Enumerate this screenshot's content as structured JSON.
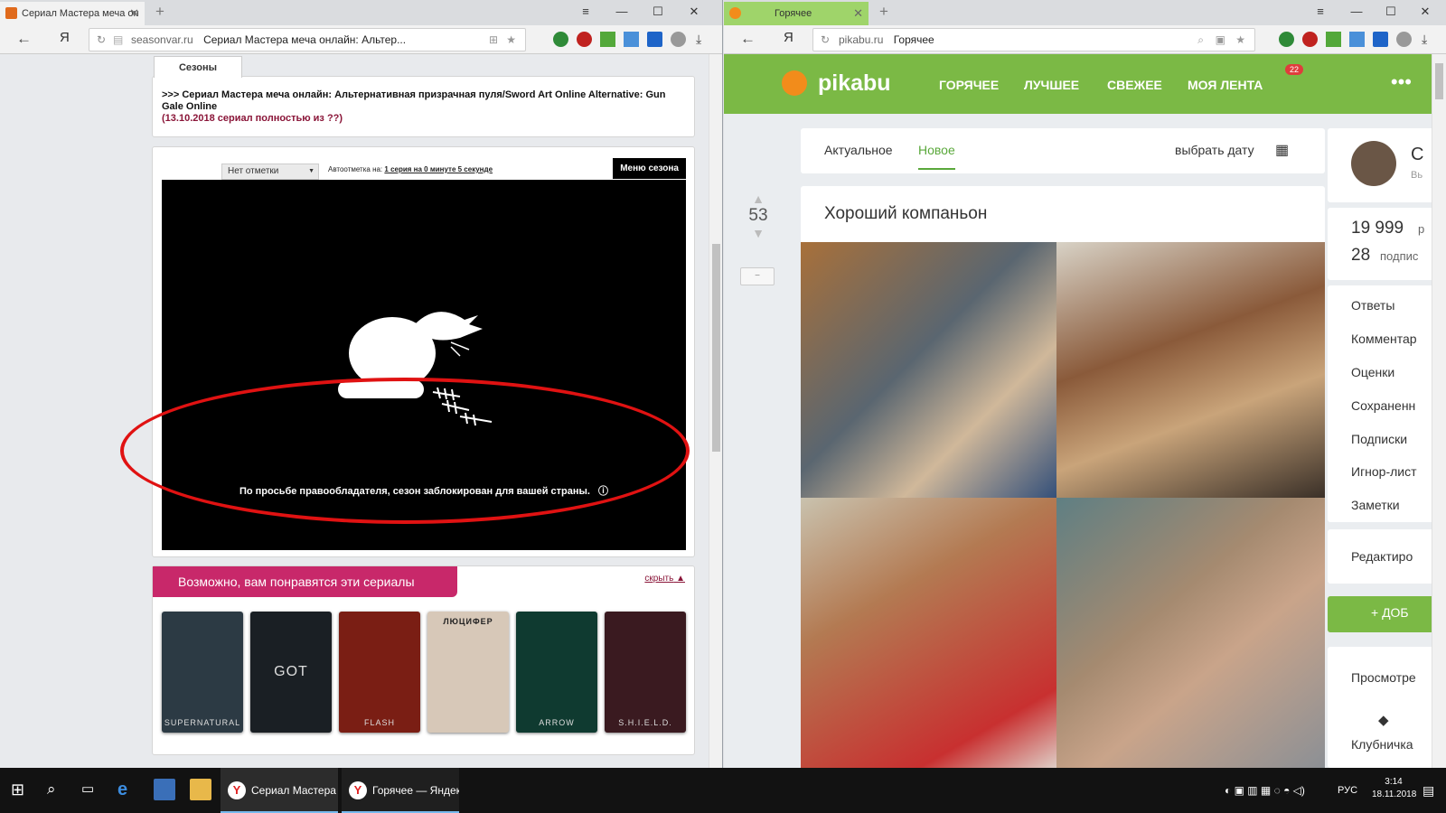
{
  "left_window": {
    "tab_title": "Сериал Мастера меча он",
    "domain": "seasonvar.ru",
    "page_title": "Сериал Мастера меча онлайн: Альтер...",
    "seasons_tab": "Сезоны",
    "series_title": ">>> Сериал Мастера меча онлайн: Альтернативная призрачная пуля/Sword Art Online Alternative: Gun Gale Online",
    "series_date": "(13.10.2018 сериал полностью из ??)",
    "mark_select": "Нет отметки",
    "automark_label": "Автоотметка на:",
    "automark_value": "1 серия на 0 минуте 5 секунде",
    "season_menu": "Меню сезона",
    "blocked_message": "По просьбе правообладателя, сезон заблокирован для вашей страны.",
    "recommend_title": "Возможно, вам понравятся эти сериалы",
    "hide_link": "скрыть",
    "posters": [
      {
        "label": "SUPERNATURAL",
        "color": "#2c3a44"
      },
      {
        "label": "GOT",
        "color": "#1a1f24"
      },
      {
        "label": "FLASH",
        "color": "#7a1e14"
      },
      {
        "label": "ЛЮЦИФЕР",
        "color": "#d7c8b8"
      },
      {
        "label": "ARROW",
        "color": "#0f3a30"
      },
      {
        "label": "S.H.I.E.L.D.",
        "color": "#3a1a20"
      }
    ]
  },
  "right_window": {
    "tab_title": "Горячее",
    "domain": "pikabu.ru",
    "page_title": "Горячее",
    "logo": "pikabu",
    "nav": [
      "ГОРЯЧЕЕ",
      "ЛУЧШЕЕ",
      "СВЕЖЕЕ",
      "МОЯ ЛЕНТА"
    ],
    "feed_badge": "22",
    "tabs": [
      "Актуальное",
      "Новое"
    ],
    "choose_date": "выбрать дату",
    "post_title": "Хороший компаньон",
    "rating": "53",
    "minus_button": "−",
    "profile_initial": "С",
    "profile_sub": "Вь",
    "stat1": "19 999",
    "stat1_suffix": "р",
    "stat2": "28",
    "stat2_suffix": "подпис",
    "menu": [
      "Ответы",
      "Комментар",
      "Оценки",
      "Сохраненн",
      "Подписки",
      "Игнор-лист",
      "Заметки"
    ],
    "edit": "Редактиро",
    "add_button": "+  ДОБ",
    "viewed": "Просмотре",
    "strawberry": "Клубничка"
  },
  "taskbar": {
    "items": [
      "Сериал Мастера м...",
      "Горячее — Яндекс..."
    ],
    "lang": "РУС",
    "time": "3:14",
    "date": "18.11.2018"
  },
  "colors": {
    "pikabu_green": "#7bb945",
    "accent_pink": "#c8286a",
    "oval_red": "#e01212"
  }
}
